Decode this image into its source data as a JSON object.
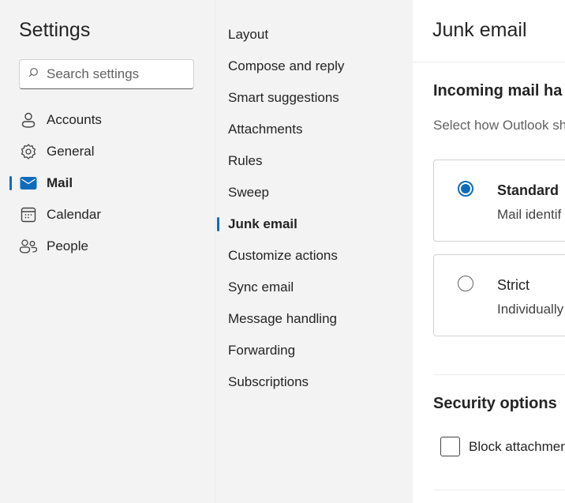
{
  "sidebar": {
    "title": "Settings",
    "search_placeholder": "Search settings",
    "items": [
      {
        "label": "Accounts",
        "icon": "person-icon",
        "active": false
      },
      {
        "label": "General",
        "icon": "gear-icon",
        "active": false
      },
      {
        "label": "Mail",
        "icon": "mail-icon",
        "active": true
      },
      {
        "label": "Calendar",
        "icon": "calendar-icon",
        "active": false
      },
      {
        "label": "People",
        "icon": "people-icon",
        "active": false
      }
    ]
  },
  "mail_nav": {
    "items": [
      {
        "label": "Layout",
        "active": false
      },
      {
        "label": "Compose and reply",
        "active": false
      },
      {
        "label": "Smart suggestions",
        "active": false
      },
      {
        "label": "Attachments",
        "active": false
      },
      {
        "label": "Rules",
        "active": false
      },
      {
        "label": "Sweep",
        "active": false
      },
      {
        "label": "Junk email",
        "active": true
      },
      {
        "label": "Customize actions",
        "active": false
      },
      {
        "label": "Sync email",
        "active": false
      },
      {
        "label": "Message handling",
        "active": false
      },
      {
        "label": "Forwarding",
        "active": false
      },
      {
        "label": "Subscriptions",
        "active": false
      }
    ]
  },
  "content": {
    "title": "Junk email",
    "incoming": {
      "heading": "Incoming mail ha",
      "description": "Select how Outlook sh",
      "options": [
        {
          "title": "Standard",
          "description": "Mail identif",
          "selected": true
        },
        {
          "title": "Strict",
          "description": "Individually",
          "selected": false
        }
      ]
    },
    "security": {
      "heading": "Security options",
      "checkbox_label": "Block attachmen",
      "checked": false
    }
  },
  "colors": {
    "accent": "#0f6cbd",
    "sidebar_bg": "#f3f3f3",
    "content_bg": "#ffffff"
  }
}
